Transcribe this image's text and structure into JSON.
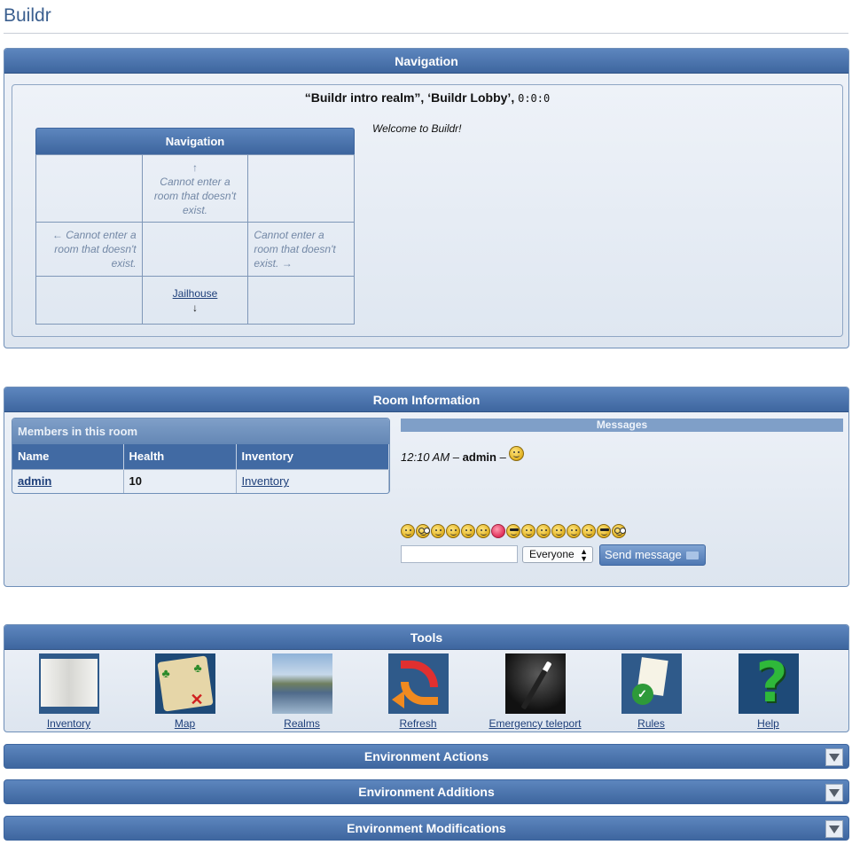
{
  "site": {
    "title": "Buildr"
  },
  "navigation_panel": {
    "header": "Navigation",
    "realm_name": "“Buildr intro realm”, ‘Buildr Lobby’,",
    "coords": "0:0:0",
    "welcome": "Welcome to Buildr!",
    "grid": {
      "header": "Navigation",
      "north": {
        "arrow": "↑",
        "text": "Cannot enter a room that doesn't exist."
      },
      "west": {
        "arrow": "←",
        "text": "Cannot enter a room that doesn't exist."
      },
      "east": {
        "arrow": "→",
        "text": "Cannot enter a room that doesn't exist."
      },
      "south": {
        "arrow": "↓",
        "link": "Jailhouse"
      }
    }
  },
  "room_info": {
    "header": "Room Information",
    "members": {
      "title": "Members in this room",
      "columns": [
        "Name",
        "Health",
        "Inventory"
      ],
      "rows": [
        {
          "name": "admin",
          "health": "10",
          "inventory": "Inventory"
        }
      ]
    },
    "messages": {
      "title": "Messages",
      "items": [
        {
          "time": "12:10 AM",
          "sep": "–",
          "user": "admin",
          "sep2": "–",
          "icon": "smiley-icon"
        }
      ]
    },
    "chat": {
      "input_value": "",
      "recipient": "Everyone",
      "send_label": "Send message"
    },
    "smileys": [
      "smile",
      "nerd",
      "sleepy",
      "grin",
      "wink",
      "confused",
      "heart",
      "cool",
      "laugh",
      "sad",
      "neutral",
      "tongue",
      "teeth",
      "sunglasses",
      "shocked"
    ]
  },
  "tools": {
    "header": "Tools",
    "items": [
      {
        "label": "Inventory",
        "icon": "book-icon"
      },
      {
        "label": "Map",
        "icon": "treasure-map-icon"
      },
      {
        "label": "Realms",
        "icon": "landscape-icon"
      },
      {
        "label": "Refresh",
        "icon": "refresh-arrow-icon"
      },
      {
        "label": "Emergency teleport",
        "icon": "magic-wand-icon"
      },
      {
        "label": "Rules",
        "icon": "checklist-icon"
      },
      {
        "label": "Help",
        "icon": "question-mark-icon"
      }
    ]
  },
  "collapsibles": [
    {
      "label": "Environment Actions"
    },
    {
      "label": "Environment Additions"
    },
    {
      "label": "Environment Modifications"
    }
  ],
  "colors": {
    "header_blue": "#3e669f",
    "link": "#1e3f7a",
    "panel_bg": "#e3e9f2"
  }
}
